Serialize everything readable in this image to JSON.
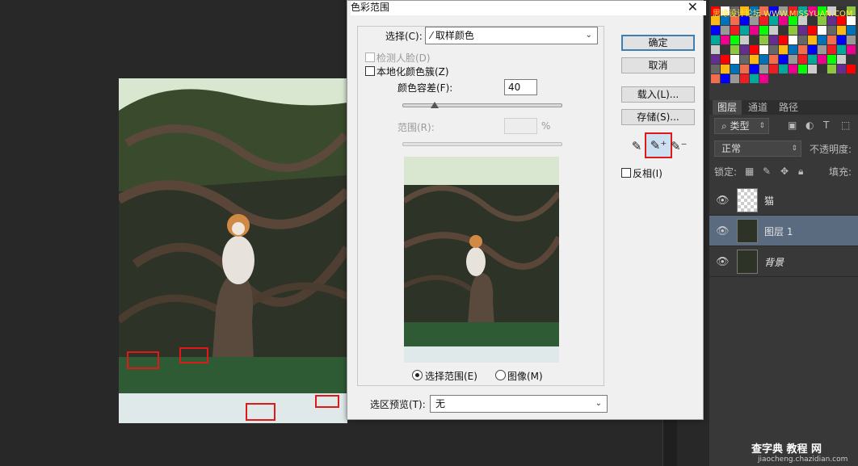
{
  "dialog": {
    "title": "色彩范围",
    "select_label": "选择(C):",
    "select_value": "取样颜色",
    "detect_faces": "检测人脸(D)",
    "localized_clusters": "本地化颜色簇(Z)",
    "fuzziness_label": "颜色容差(F):",
    "fuzziness_value": "40",
    "fuzziness_fraction": 0.2,
    "range_label": "范围(R):",
    "range_unit": "%",
    "radio_selection": "选择范围(E)",
    "radio_image": "图像(M)",
    "preview_label": "选区预览(T):",
    "preview_value": "无",
    "ok": "确定",
    "cancel": "取消",
    "load": "载入(L)...",
    "save": "存储(S)...",
    "invert": "反相(I)"
  },
  "panels": {
    "tabs": [
      "图层",
      "通道",
      "路径"
    ],
    "filter_kind": "类型",
    "blend_mode": "正常",
    "opacity_label": "不透明度:",
    "lock_label": "锁定:",
    "fill_label": "填充:",
    "layers": [
      {
        "name": "猫",
        "selected": false
      },
      {
        "name": "图层 1",
        "selected": true
      },
      {
        "name": "背景",
        "selected": false
      }
    ]
  },
  "watermark": {
    "top": "思缘设计论坛 WWW.MISSYUAN.COM",
    "bottom": "查字典 教程 网",
    "url": "jiaocheng.chazidian.com"
  },
  "colors": {
    "selection_box": "#e01818",
    "swatches": [
      "#ff0000",
      "#ffff00",
      "#00ff00",
      "#00ffff",
      "#0000ff",
      "#ff00ff",
      "#ffffff",
      "#e6e6e6",
      "#cccccc",
      "#b3b3b3",
      "#999999",
      "#808080",
      "#666666",
      "#4d4d4d",
      "#333333",
      "#1a1a1a",
      "#ee1d24",
      "#f36622",
      "#fdb813",
      "#fff200",
      "#8dc63f",
      "#00a651",
      "#00a99d",
      "#00aeef",
      "#0072bc",
      "#2e3192",
      "#662d91",
      "#92278f",
      "#ec008c",
      "#ed145b",
      "#f26c4f",
      "#f69679"
    ]
  }
}
